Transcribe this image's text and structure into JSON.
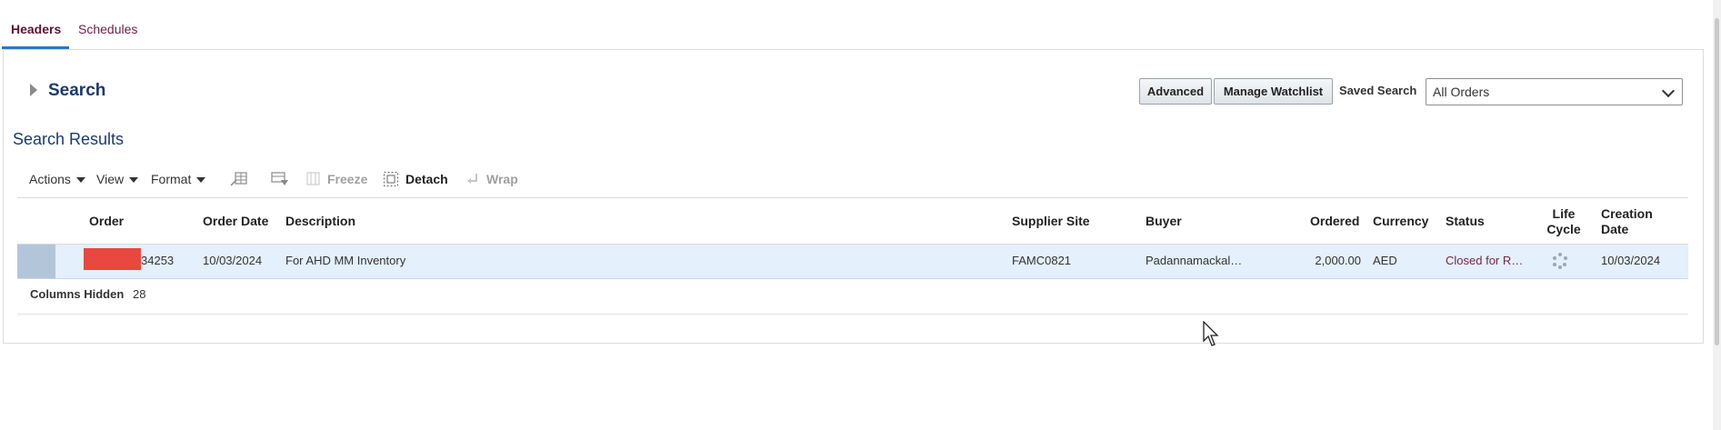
{
  "tabs": [
    {
      "label": "Headers",
      "active": true
    },
    {
      "label": "Schedules",
      "active": false
    }
  ],
  "search": {
    "title": "Search",
    "advanced_button": "Advanced",
    "watchlist_button": "Manage Watchlist",
    "saved_search_label": "Saved Search",
    "saved_search_value": "All Orders"
  },
  "results": {
    "title": "Search Results",
    "toolbar": {
      "actions": "Actions",
      "view": "View",
      "format": "Format",
      "freeze": "Freeze",
      "detach": "Detach",
      "wrap": "Wrap"
    },
    "columns": {
      "order": "Order",
      "order_date": "Order Date",
      "description": "Description",
      "supplier_site": "Supplier Site",
      "buyer": "Buyer",
      "ordered": "Ordered",
      "currency": "Currency",
      "status": "Status",
      "life_cycle_1": "Life",
      "life_cycle_2": "Cycle",
      "creation_date_1": "Creation",
      "creation_date_2": "Date"
    },
    "rows": [
      {
        "order_suffix": "34253",
        "order_date": "10/03/2024",
        "description": "For AHD MM Inventory",
        "supplier_site": "FAMC0821",
        "buyer": "Padannamackal…",
        "ordered": "2,000.00",
        "currency": "AED",
        "status": "Closed for R…",
        "creation_date": "10/03/2024"
      }
    ],
    "columns_hidden_label": "Columns Hidden",
    "columns_hidden_count": "28"
  },
  "colors": {
    "accent_blue": "#2a76c6",
    "tab_active": "#5a1432",
    "row_selected": "#e4f0fb",
    "redaction": "#e8483f"
  }
}
